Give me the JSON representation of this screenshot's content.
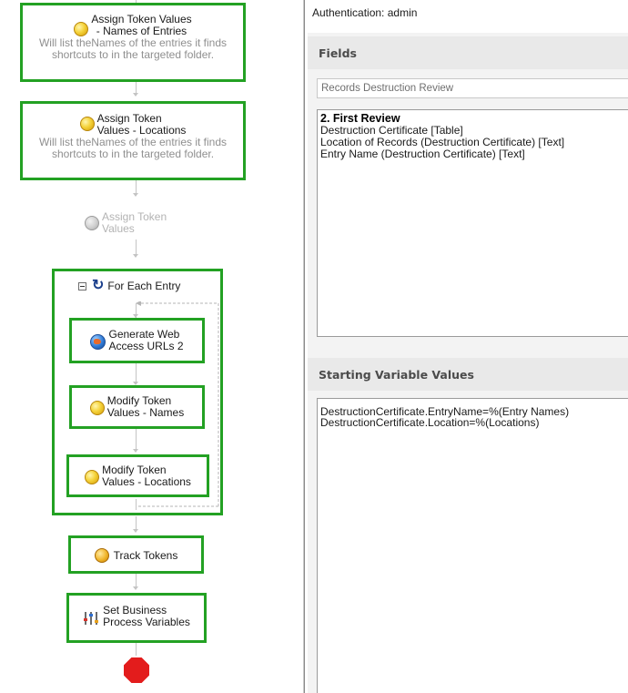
{
  "workflow": {
    "assign_names": {
      "title_line1": "Assign Token Values",
      "title_line2": "- Names of Entries",
      "description_line1": "Will list theNames of the entries it finds",
      "description_line2": "shortcuts to in the targeted folder."
    },
    "assign_locations": {
      "title_line1": "Assign Token",
      "title_line2": "Values - Locations",
      "description_line1": "Will list theNames of the entries it finds",
      "description_line2": "shortcuts to in the targeted folder."
    },
    "assign_disabled": {
      "title_line1": "Assign Token",
      "title_line2": "Values"
    },
    "for_each": {
      "title": "For Each Entry",
      "activities": [
        {
          "line1": "Generate Web",
          "line2": "Access URLs 2",
          "icon": "globe-icon"
        },
        {
          "line1": "Modify Token",
          "line2": "Values - Names",
          "icon": "token-icon"
        },
        {
          "line1": "Modify Token",
          "line2": "Values - Locations",
          "icon": "token-icon"
        }
      ]
    },
    "track_tokens": {
      "label": "Track Tokens",
      "icon": "track-tokens-icon"
    },
    "set_variables": {
      "line1": "Set Business",
      "line2": "Process Variables",
      "icon": "variables-icon"
    },
    "end": {
      "icon": "stop-icon",
      "color": "#e31c1c"
    }
  },
  "panel": {
    "authentication": "Authentication:  admin",
    "fields_header": "Fields",
    "form_selected": "Records Destruction Review",
    "fields_heading": "2. First Review",
    "fields": [
      "Destruction Certificate [Table]",
      "Location of Records (Destruction Certificate) [Text]",
      "Entry Name (Destruction Certificate) [Text]"
    ],
    "starting_variables_header": "Starting Variable Values",
    "starting_variables": [
      "DestructionCertificate.EntryName=%(Entry Names)",
      "DestructionCertificate.Location=%(Locations)"
    ]
  },
  "colors": {
    "activity_border": "#23a123",
    "description_text": "#8f8f8f",
    "disabled_text": "#b3b3b3"
  }
}
